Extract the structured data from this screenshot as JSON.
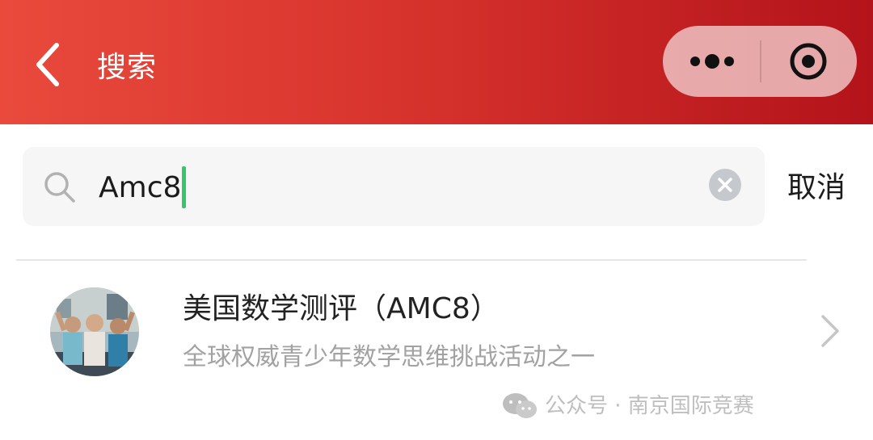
{
  "colors": {
    "nav_gradient_start": "#e94a3c",
    "nav_gradient_end": "#b3131a",
    "caret": "#35c56a",
    "capsule_bg": "#f0c8c8"
  },
  "nav": {
    "back_icon": "chevron-left-icon",
    "title": "搜索",
    "capsule": {
      "more_icon": "more-dots-icon",
      "close_icon": "target-circle-icon"
    }
  },
  "search": {
    "icon": "search-icon",
    "value": "Amc8",
    "clear_icon": "clear-circle-icon",
    "cancel_label": "取消"
  },
  "results": [
    {
      "avatar": "avatar-students-photo",
      "title": "美国数学测评（AMC8）",
      "description": "全球权威青少年数学思维挑战活动之一",
      "chevron_icon": "chevron-right-icon"
    }
  ],
  "watermark": {
    "icon": "wechat-icon",
    "text": "公众号 · 南京国际竞赛"
  }
}
